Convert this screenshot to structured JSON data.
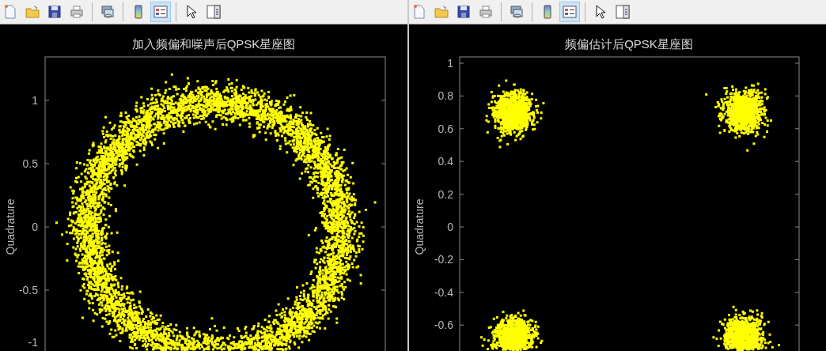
{
  "figures": [
    {
      "kind": "ring",
      "toolbar_groups": [
        {
          "buttons": [
            {
              "kind": "new",
              "selected": false
            },
            {
              "kind": "open",
              "selected": false
            },
            {
              "kind": "save",
              "selected": false
            },
            {
              "kind": "print",
              "selected": false
            }
          ]
        },
        {
          "buttons": [
            {
              "kind": "link",
              "selected": false
            }
          ]
        },
        {
          "buttons": [
            {
              "kind": "colorbar",
              "selected": false
            },
            {
              "kind": "legend",
              "selected": true
            }
          ]
        },
        {
          "buttons": [
            {
              "kind": "pointer",
              "selected": false
            },
            {
              "kind": "browser",
              "selected": false
            }
          ]
        }
      ],
      "title": "加入频偏和噪声后QPSK星座图",
      "ylabel": "Quadrature",
      "yticks": [
        "1",
        "0.5",
        "0",
        "-0.5",
        "-1"
      ]
    },
    {
      "kind": "clusters",
      "toolbar_groups": [
        {
          "buttons": [
            {
              "kind": "new",
              "selected": false
            },
            {
              "kind": "open",
              "selected": false
            },
            {
              "kind": "save",
              "selected": false
            },
            {
              "kind": "print",
              "selected": false
            }
          ]
        },
        {
          "buttons": [
            {
              "kind": "link",
              "selected": false
            }
          ]
        },
        {
          "buttons": [
            {
              "kind": "colorbar",
              "selected": false
            },
            {
              "kind": "legend",
              "selected": true
            }
          ]
        },
        {
          "buttons": [
            {
              "kind": "pointer",
              "selected": false
            },
            {
              "kind": "browser",
              "selected": false
            }
          ]
        }
      ],
      "title": "频偏估计后QPSK星座图",
      "ylabel": "Quadrature",
      "yticks": [
        "1",
        "0.8",
        "0.6",
        "0.4",
        "0.2",
        "0",
        "-0.2",
        "-0.4",
        "-0.6"
      ]
    }
  ]
}
